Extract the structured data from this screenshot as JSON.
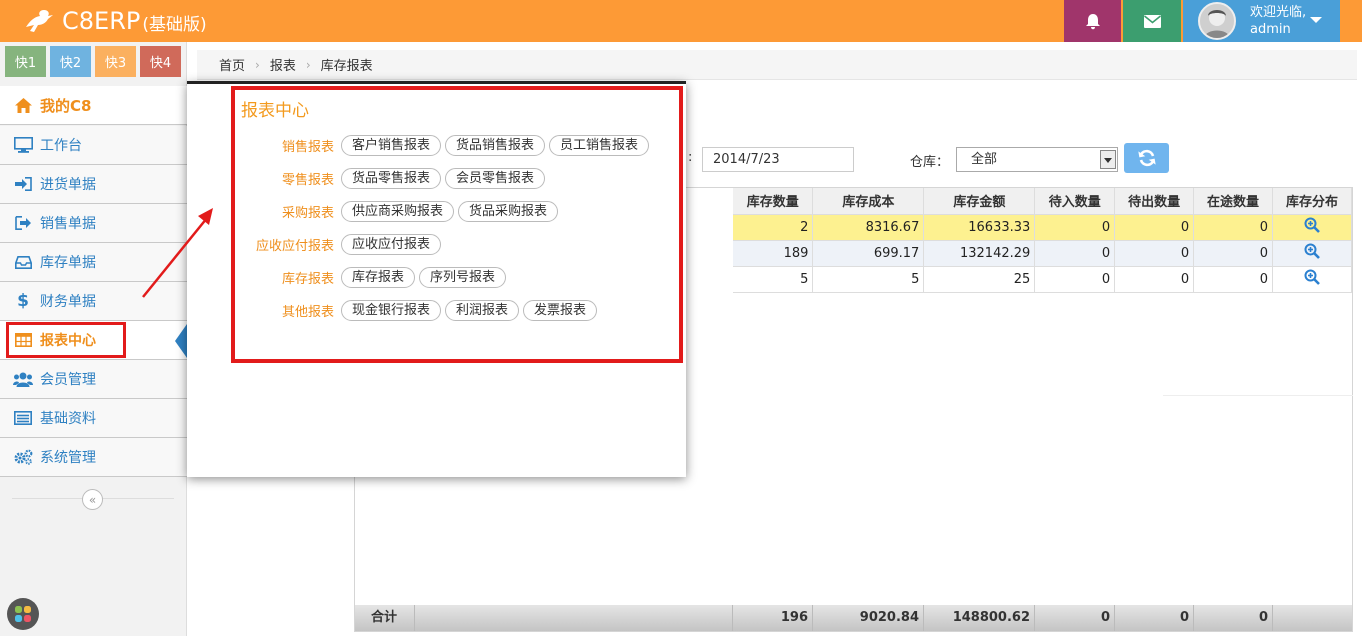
{
  "header": {
    "brand": "C8ERP",
    "edition": "(基础版)",
    "welcome": "欢迎光临,",
    "username": "admin",
    "colors": {
      "topbar": "#fd9a36",
      "bell": "#a0356b",
      "mail": "#3c9e6f",
      "user": "#4a9fd8"
    }
  },
  "quick": [
    "快1",
    "快2",
    "快3",
    "快4"
  ],
  "sidebar": {
    "items": [
      {
        "label": "我的C8",
        "icon": "home-icon"
      },
      {
        "label": "工作台",
        "icon": "desktop-icon"
      },
      {
        "label": "进货单据",
        "icon": "sign-in-icon"
      },
      {
        "label": "销售单据",
        "icon": "sign-out-icon"
      },
      {
        "label": "库存单据",
        "icon": "inbox-icon"
      },
      {
        "label": "财务单据",
        "icon": "dollar-icon"
      },
      {
        "label": "报表中心",
        "icon": "table-icon"
      },
      {
        "label": "会员管理",
        "icon": "users-icon"
      },
      {
        "label": "基础资料",
        "icon": "list-icon"
      },
      {
        "label": "系统管理",
        "icon": "cogs-icon"
      }
    ],
    "collapse_glyph": "«"
  },
  "breadcrumb": [
    "首页",
    "报表",
    "库存报表"
  ],
  "filters": {
    "colon": ":",
    "date": "2014/7/23",
    "warehouse_label": "仓库：",
    "warehouse_value": "全部"
  },
  "table": {
    "columns": [
      "库存数量",
      "库存成本",
      "库存金额",
      "待入数量",
      "待出数量",
      "在途数量",
      "库存分布"
    ],
    "rows": [
      [
        "2",
        "8316.67",
        "16633.33",
        "0",
        "0",
        "0"
      ],
      [
        "189",
        "699.17",
        "132142.29",
        "0",
        "0",
        "0"
      ],
      [
        "5",
        "5",
        "25",
        "0",
        "0",
        "0"
      ]
    ],
    "footer_label": "合计",
    "footer": [
      "196",
      "9020.84",
      "148800.62",
      "0",
      "0",
      "0"
    ]
  },
  "report_center": {
    "title": "报表中心",
    "groups": [
      {
        "category": "销售报表",
        "items": [
          "客户销售报表",
          "货品销售报表",
          "员工销售报表"
        ]
      },
      {
        "category": "零售报表",
        "items": [
          "货品零售报表",
          "会员零售报表"
        ]
      },
      {
        "category": "采购报表",
        "items": [
          "供应商采购报表",
          "货品采购报表"
        ]
      },
      {
        "category": "应收应付报表",
        "items": [
          "应收应付报表"
        ]
      },
      {
        "category": "库存报表",
        "items": [
          "库存报表",
          "序列号报表"
        ]
      },
      {
        "category": "其他报表",
        "items": [
          "现金银行报表",
          "利润报表",
          "发票报表"
        ]
      }
    ]
  }
}
